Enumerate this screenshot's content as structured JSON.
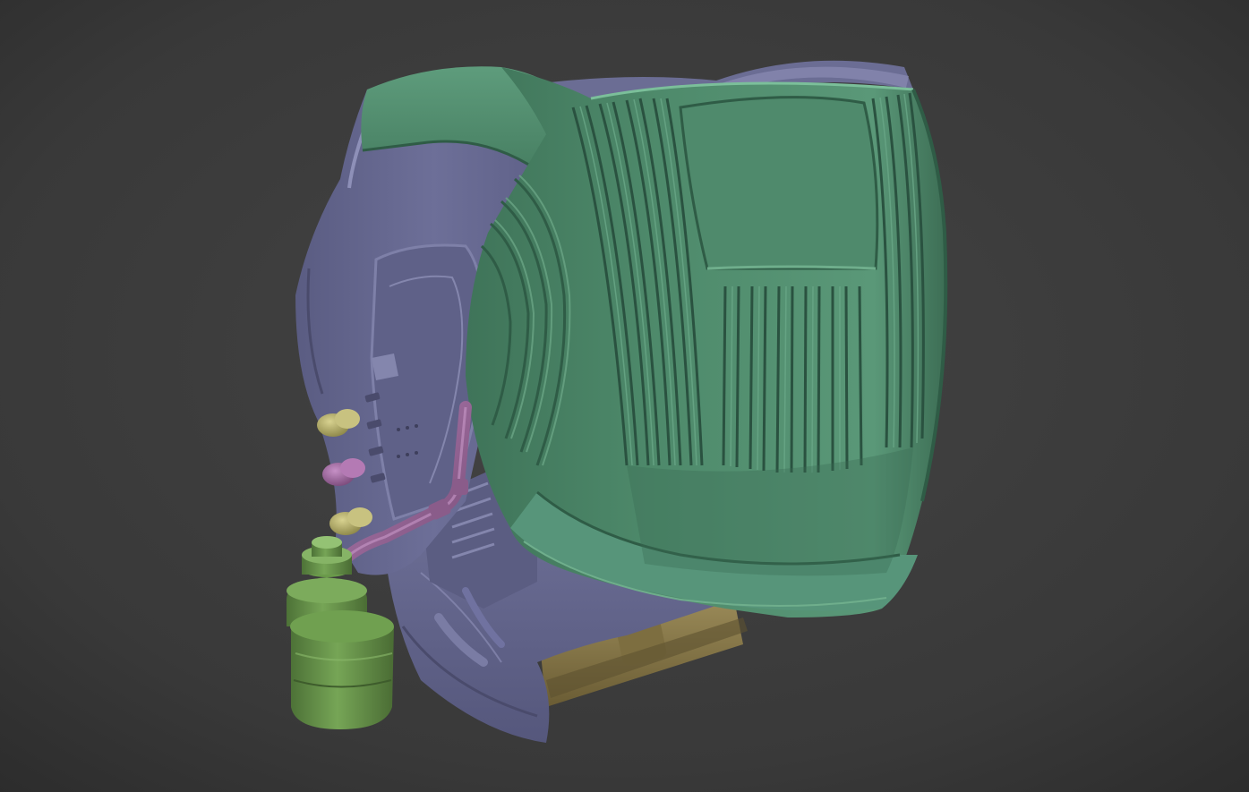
{
  "scene": {
    "subject": "",
    "background_color": "#3a3a3a",
    "vignette_color": "#2a2a2a",
    "colors": {
      "shell_green": "#4f8a6a",
      "shell_green_dark": "#2f5c46",
      "shell_green_light": "#6aa585",
      "inner_purple": "#6b6d94",
      "inner_purple_dark": "#4a4b6c",
      "inner_purple_light": "#8a8cb4",
      "tube_magenta": "#9a6a9a",
      "canister_green": "#6a9a4a",
      "canister_green_dark": "#4a6e34",
      "knob_yellow": "#b8b26a",
      "knob_magenta": "#a46aa4",
      "cylinder_bronze": "#8a7a4a"
    }
  }
}
